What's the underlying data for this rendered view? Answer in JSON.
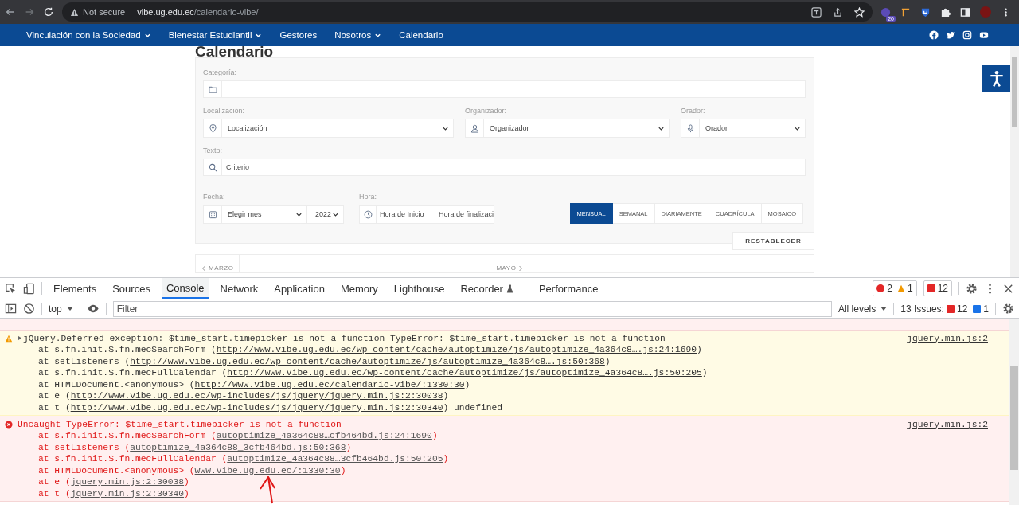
{
  "browser": {
    "security": "Not secure",
    "host": "vibe.ug.edu.ec",
    "path": "/calendario-vibe/",
    "extension_badge": "20"
  },
  "nav": {
    "items": [
      {
        "label": "Vinculación con la Sociedad",
        "dropdown": true
      },
      {
        "label": "Bienestar Estudiantil",
        "dropdown": true
      },
      {
        "label": "Gestores",
        "dropdown": false
      },
      {
        "label": "Nosotros",
        "dropdown": true
      },
      {
        "label": "Calendario",
        "dropdown": false
      }
    ]
  },
  "page": {
    "title": "Calendario",
    "form": {
      "category": {
        "label": "Categoría:"
      },
      "location": {
        "label": "Localización:",
        "value": "Localización"
      },
      "organizer": {
        "label": "Organizador:",
        "value": "Organizador"
      },
      "speaker": {
        "label": "Orador:",
        "value": "Orador"
      },
      "text": {
        "label": "Texto:",
        "placeholder": "Criterio"
      },
      "date": {
        "label": "Fecha:",
        "month": "Elegir mes",
        "year": "2022"
      },
      "time": {
        "label": "Hora:",
        "start_placeholder": "Hora de Inicio",
        "end_placeholder": "Hora de finalizaci"
      },
      "views": [
        {
          "label": "MENSUAL",
          "selected": true
        },
        {
          "label": "SEMANAL",
          "selected": false
        },
        {
          "label": "DIARIAMENTE",
          "selected": false
        },
        {
          "label": "CUADRÍCULA",
          "selected": false
        },
        {
          "label": "MOSAICO",
          "selected": false
        }
      ],
      "reset": "RESTABLECER"
    },
    "pager": {
      "prev": "MARZO",
      "next": "MAYO"
    }
  },
  "devtools": {
    "tabs": [
      {
        "label": "Elements",
        "selected": false,
        "kind": "plain"
      },
      {
        "label": "Sources",
        "selected": false,
        "kind": "plain"
      },
      {
        "label": "Console",
        "selected": true,
        "kind": "plain"
      },
      {
        "label": "Network",
        "selected": false,
        "kind": "plain"
      },
      {
        "label": "Application",
        "selected": false,
        "kind": "plain"
      },
      {
        "label": "Memory",
        "selected": false,
        "kind": "plain"
      },
      {
        "label": "Lighthouse",
        "selected": false,
        "kind": "plain"
      },
      {
        "label": "Recorder",
        "selected": false,
        "kind": "experimental"
      },
      {
        "label": "Performance",
        "selected": false,
        "kind": "plain"
      }
    ],
    "counters": {
      "errors": "2",
      "warnings": "1",
      "issues": "12"
    },
    "toolbar": {
      "context": "top",
      "filter_placeholder": "Filter",
      "levels": "All levels",
      "issues_label": "13 Issues:",
      "issues_errors": "12",
      "issues_info": "1"
    },
    "messages": [
      {
        "kind": "warning",
        "text": "jQuery.Deferred exception: $time_start.timepicker is not a function TypeError: $time_start.timepicker is not a function",
        "source": "jquery.min.js:2",
        "frames": [
          {
            "pre": "at s.fn.init.$.fn.mecSearchForm (",
            "link": "http://www.vibe.ug.edu.ec/wp-content/cache/autoptimize/js/autoptimize_4a364c8….js:24:1690",
            "post": ")"
          },
          {
            "pre": "at setListeners (",
            "link": "http://www.vibe.ug.edu.ec/wp-content/cache/autoptimize/js/autoptimize_4a364c8….js:50:368",
            "post": ")"
          },
          {
            "pre": "at s.fn.init.$.fn.mecFullCalendar (",
            "link": "http://www.vibe.ug.edu.ec/wp-content/cache/autoptimize/js/autoptimize_4a364c8….js:50:205",
            "post": ")"
          },
          {
            "pre": "at HTMLDocument.<anonymous> (",
            "link": "http://www.vibe.ug.edu.ec/calendario-vibe/:1330:30",
            "post": ")"
          },
          {
            "pre": "at e (",
            "link": "http://www.vibe.ug.edu.ec/wp-includes/js/jquery/jquery.min.js:2:30038",
            "post": ")"
          },
          {
            "pre": "at t (",
            "link": "http://www.vibe.ug.edu.ec/wp-includes/js/jquery/jquery.min.js:2:30340",
            "post": ") undefined"
          }
        ]
      },
      {
        "kind": "error",
        "text": "Uncaught TypeError: $time_start.timepicker is not a function",
        "source": "jquery.min.js:2",
        "frames": [
          {
            "pre": "at s.fn.init.$.fn.mecSearchForm (",
            "link": "autoptimize_4a364c88…cfb464bd.js:24:1690",
            "post": ")"
          },
          {
            "pre": "at setListeners (",
            "link": "autoptimize_4a364c88_3cfb464bd.js:50:368",
            "post": ")"
          },
          {
            "pre": "at s.fn.init.$.fn.mecFullCalendar (",
            "link": "autoptimize_4a364c88…3cfb464bd.js:50:205",
            "post": ")"
          },
          {
            "pre": "at HTMLDocument.<anonymous> (",
            "link": "www.vibe.ug.edu.ec/:1330:30",
            "post": ")"
          },
          {
            "pre": "at e (",
            "link": "jquery.min.js:2:30038",
            "post": ")"
          },
          {
            "pre": "at t (",
            "link": "jquery.min.js:2:30340",
            "post": ")"
          }
        ]
      }
    ]
  }
}
